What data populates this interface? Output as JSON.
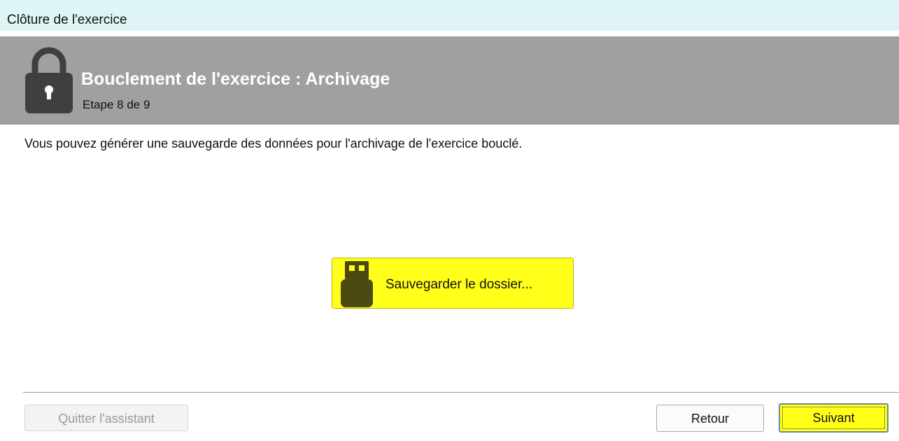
{
  "window": {
    "title": "Clôture de l'exercice"
  },
  "header": {
    "title": "Bouclement de l'exercice : Archivage",
    "step": "Etape 8 de 9",
    "icon": "lock-icon",
    "background": "#a0a0a0"
  },
  "main": {
    "description": "Vous pouvez générer une sauvegarde des données pour l'archivage de l'exercice bouclé.",
    "save_button": {
      "label": "Sauvegarder le dossier...",
      "icon": "usb-drive-icon",
      "highlight_color": "#ffff1a"
    }
  },
  "footer": {
    "quit_label": "Quitter l'assistant",
    "quit_enabled": false,
    "back_label": "Retour",
    "next_label": "Suivant",
    "next_highlight_color": "#ffff1a"
  }
}
